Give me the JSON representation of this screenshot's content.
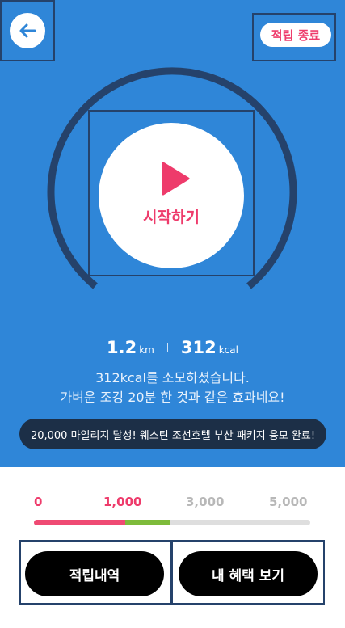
{
  "header": {
    "back_icon": "arrow-left-icon",
    "end_button_label": "적립 종료"
  },
  "start": {
    "play_icon": "play-triangle-icon",
    "label": "시작하기"
  },
  "stats": {
    "distance_value": "1.2",
    "distance_unit": "km",
    "calories_value": "312",
    "calories_unit": "kcal"
  },
  "description": {
    "line1": "312kcal를 소모하셨습니다.",
    "line2": "가벼운 조깅 20분 한 것과 같은 효과네요!"
  },
  "banner": {
    "text": "20,000 마일리지 달성! 웨스틴 조선호텔 부산 패키지  응모 완료!"
  },
  "progress": {
    "labels": [
      "0",
      "1,000",
      "3,000",
      "5,000"
    ],
    "pink_fraction": 0.33,
    "green_fraction": 0.16
  },
  "buttons": {
    "history_label": "적립내역",
    "benefits_label": "내 혜택 보기"
  },
  "colors": {
    "background_blue": "#2f86d8",
    "ring": "#25426b",
    "accent_pink": "#ee3b6b",
    "progress_green": "#7ebb3b",
    "banner_dark": "#1c2f47"
  }
}
